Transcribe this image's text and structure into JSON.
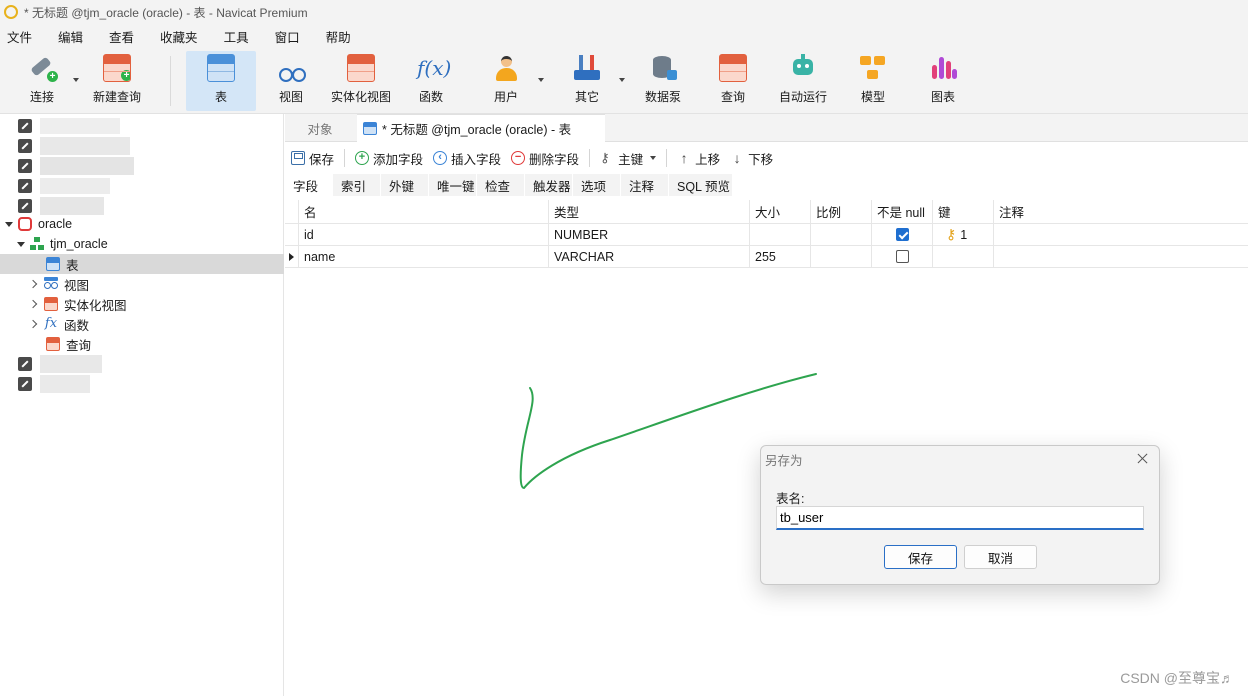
{
  "window": {
    "title": "* 无标题 @tjm_oracle (oracle) - 表 - Navicat Premium"
  },
  "menu": [
    "文件",
    "编辑",
    "查看",
    "收藏夹",
    "工具",
    "窗口",
    "帮助"
  ],
  "toolbar": {
    "connect": "连接",
    "new_query": "新建查询",
    "table": "表",
    "view": "视图",
    "materialized_view": "实体化视图",
    "function": "函数",
    "user": "用户",
    "other": "其它",
    "data_pump": "数据泵",
    "query": "查询",
    "automation": "自动运行",
    "model": "模型",
    "chart": "图表"
  },
  "tree": {
    "connection": "oracle",
    "schema": "tjm_oracle",
    "items": [
      "表",
      "视图",
      "实体化视图",
      "函数",
      "查询"
    ]
  },
  "tabs": {
    "objects": "对象",
    "active": "* 无标题 @tjm_oracle (oracle) - 表"
  },
  "actions": {
    "save": "保存",
    "add_field": "添加字段",
    "insert_field": "插入字段",
    "delete_field": "删除字段",
    "primary_key": "主键",
    "move_up": "上移",
    "move_down": "下移"
  },
  "subtabs": [
    "字段",
    "索引",
    "外键",
    "唯一键",
    "检查",
    "触发器",
    "选项",
    "注释",
    "SQL 预览"
  ],
  "grid": {
    "columns": [
      "名",
      "类型",
      "大小",
      "比例",
      "不是 null",
      "键",
      "注释"
    ],
    "rows": [
      {
        "name": "id",
        "type": "NUMBER",
        "size": "",
        "scale": "",
        "not_null": true,
        "key": "1",
        "comment": ""
      },
      {
        "name": "name",
        "type": "VARCHAR",
        "size": "255",
        "scale": "",
        "not_null": false,
        "key": "",
        "comment": ""
      }
    ]
  },
  "dialog": {
    "title": "另存为",
    "label": "表名:",
    "value": "tb_user",
    "ok": "保存",
    "cancel": "取消"
  },
  "watermark": "CSDN @至尊宝♬",
  "colors": {
    "accent": "#2a6fc6",
    "toolbar_active": "#d4e6f7",
    "annotation_stroke": "#2ea44f"
  }
}
